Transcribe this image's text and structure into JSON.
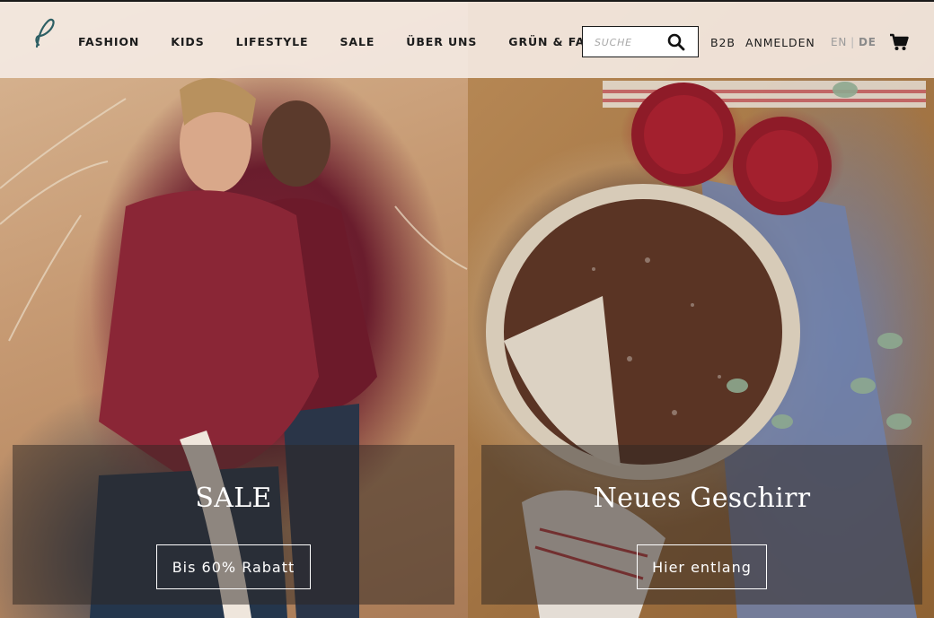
{
  "header": {
    "logo_icon": "leaf-letter-logo",
    "nav": [
      "FASHION",
      "KIDS",
      "LIFESTYLE",
      "SALE",
      "ÜBER UNS",
      "GRÜN & FAIR"
    ],
    "search": {
      "placeholder": "SUCHE",
      "value": "",
      "icon": "search-icon"
    },
    "b2b": "B2B",
    "login": "ANMELDEN",
    "lang": {
      "en": "EN",
      "separator": "|",
      "de": "DE",
      "active": "DE"
    },
    "cart_icon": "cart-icon"
  },
  "hero": {
    "left": {
      "title": "SALE",
      "button": "Bis 60% Rabatt"
    },
    "right": {
      "title": "Neues Geschirr",
      "button": "Hier entlang"
    }
  },
  "colors": {
    "header_bg": "#f5ebe4",
    "text_dark": "#1c1c1c",
    "promo_overlay": "#2d2622",
    "white": "#ffffff"
  }
}
